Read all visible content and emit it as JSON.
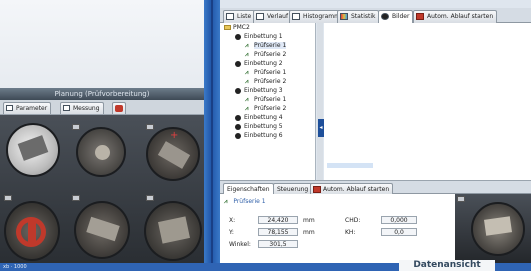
{
  "planning_panel": {
    "title": "Planung (Prüfvorbereitung)",
    "tabs": [
      {
        "label": "Parameter",
        "icon": "parameter-icon"
      },
      {
        "label": "Messung",
        "icon": "measure-icon"
      },
      {
        "label": "",
        "icon": "red-mount-icon"
      }
    ],
    "thumbnails": [
      "sample-thumbnail-1",
      "sample-thumbnail-2",
      "sample-thumbnail-3",
      "sample-thumbnail-4",
      "sample-thumbnail-5",
      "sample-thumbnail-6"
    ]
  },
  "top_tabs": [
    {
      "label": "Liste",
      "icon": "list-icon"
    },
    {
      "label": "Verlauf",
      "icon": "history-icon"
    },
    {
      "label": "Histogramm",
      "icon": "histogram-icon"
    },
    {
      "label": "Statistik",
      "icon": "statistics-icon"
    },
    {
      "label": "Bilder",
      "icon": "camera-icon",
      "active": true
    },
    {
      "label": "Autom. Ablauf starten",
      "icon": "red-mount-icon"
    }
  ],
  "tree": [
    {
      "label": "PMC2",
      "kind": "folder",
      "level": 0
    },
    {
      "label": "Einbettung 1",
      "kind": "node",
      "level": 1
    },
    {
      "label": "Prüfserie 1",
      "kind": "chart",
      "level": 2,
      "selected": true
    },
    {
      "label": "Prüfserie 2",
      "kind": "chart",
      "level": 2
    },
    {
      "label": "Einbettung 2",
      "kind": "node",
      "level": 1
    },
    {
      "label": "Prüfserie 1",
      "kind": "chart",
      "level": 2
    },
    {
      "label": "Prüfserie 2",
      "kind": "chart",
      "level": 2
    },
    {
      "label": "Einbettung 3",
      "kind": "node",
      "level": 1
    },
    {
      "label": "Prüfserie 1",
      "kind": "chart",
      "level": 2
    },
    {
      "label": "Prüfserie 2",
      "kind": "chart",
      "level": 2
    },
    {
      "label": "Einbettung 4",
      "kind": "node",
      "level": 1
    },
    {
      "label": "Einbettung 5",
      "kind": "node",
      "level": 1
    },
    {
      "label": "Einbettung 6",
      "kind": "node",
      "level": 1
    }
  ],
  "bottom_tabs": [
    {
      "label": "Eigenschaften",
      "active": true
    },
    {
      "label": "Steuerung"
    },
    {
      "label": "Autom. Ablauf starten",
      "icon": "red-mount-icon"
    }
  ],
  "properties": {
    "probe_label": "Prüfserie 1",
    "x_label": "X:",
    "x_value": "24,420",
    "x_unit": "mm",
    "y_label": "Y:",
    "y_value": "78,155",
    "y_unit": "mm",
    "angle_label": "Winkel:",
    "angle_value": "301,5",
    "chd_label": "CHD:",
    "chd_value": "0,000",
    "kh_label": "KH:",
    "kh_value": "0,0"
  },
  "status": {
    "left_text": "xb · 1000",
    "view_label": "Datenansicht"
  },
  "colors": {
    "accent": "#2f64b4",
    "splitter": "#2156a8"
  }
}
